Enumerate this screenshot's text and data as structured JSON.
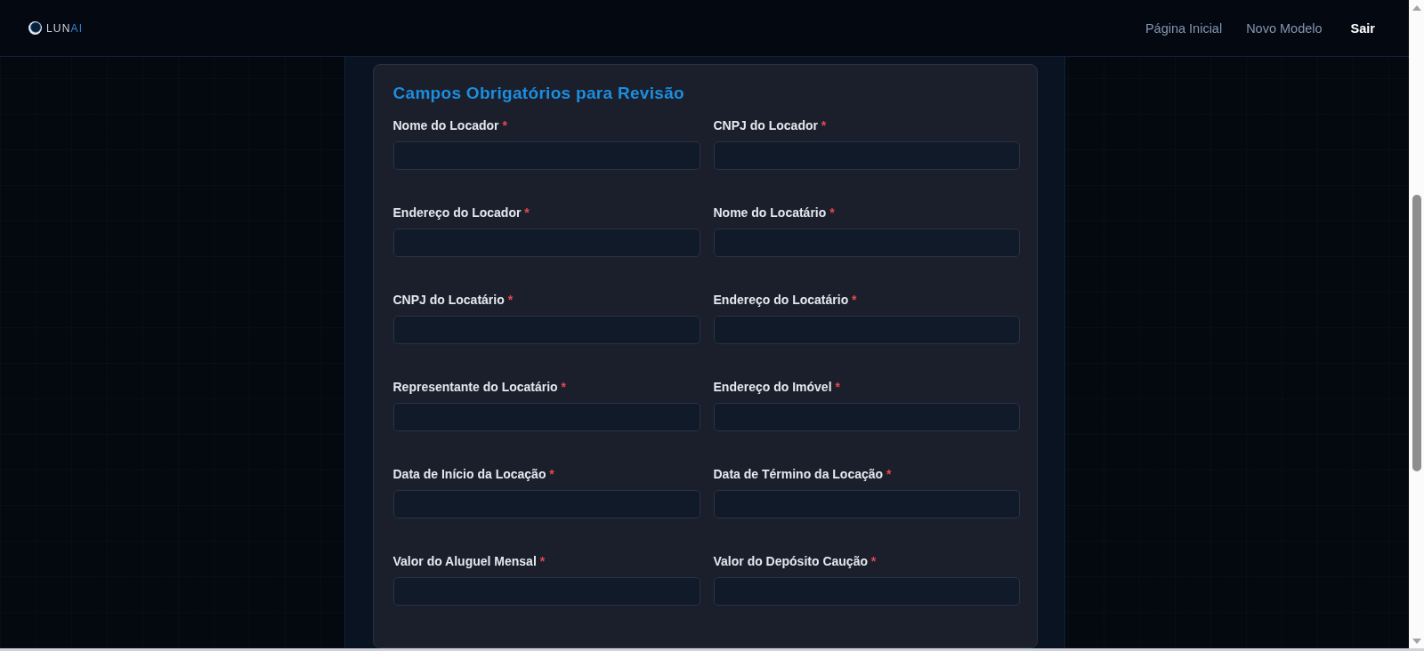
{
  "header": {
    "logo": {
      "text": "LUN",
      "accent": "AI"
    },
    "nav": [
      {
        "label": "Página Inicial",
        "kind": "link"
      },
      {
        "label": "Novo Modelo",
        "kind": "link"
      },
      {
        "label": "Sair",
        "kind": "action"
      }
    ]
  },
  "form": {
    "title": "Campos Obrigatórios para Revisão",
    "fields": [
      {
        "label": "Nome do Locador",
        "required_mark": "*"
      },
      {
        "label": "CNPJ do Locador",
        "required_mark": "*"
      },
      {
        "label": "Endereço do Locador",
        "required_mark": "*"
      },
      {
        "label": "Nome do Locatário",
        "required_mark": "*"
      },
      {
        "label": "CNPJ do Locatário",
        "required_mark": "*"
      },
      {
        "label": "Endereço do Locatário",
        "required_mark": "*"
      },
      {
        "label": "Representante do Locatário",
        "required_mark": "*"
      },
      {
        "label": "Endereço do Imóvel",
        "required_mark": "*"
      },
      {
        "label": "Data de Início da Locação",
        "required_mark": "*"
      },
      {
        "label": "Data de Término da Locação",
        "required_mark": "*"
      },
      {
        "label": "Valor do Aluguel Mensal",
        "required_mark": "*"
      },
      {
        "label": "Valor do Depósito Caução",
        "required_mark": "*"
      }
    ]
  }
}
